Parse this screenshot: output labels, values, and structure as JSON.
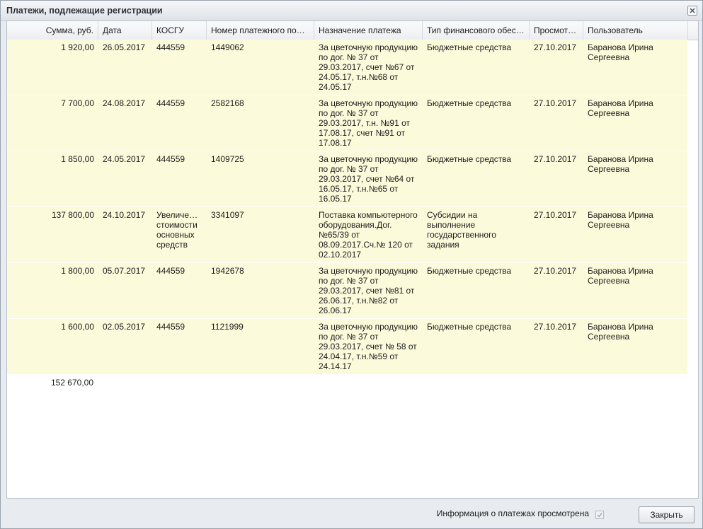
{
  "dialog": {
    "title": "Платежи, подлежащие регистрации"
  },
  "table": {
    "columns": [
      "Сумма, руб.",
      "Дата",
      "КОСГУ",
      "Номер платежного пор…",
      "Назначение платежа",
      "Тип финансового обес…",
      "Просмот…",
      "Пользователь"
    ],
    "rows": [
      [
        "1 920,00",
        "26.05.2017",
        "444559",
        "1449062",
        "За цветочную продукцию по дог. № 37 от 29.03.2017, счет №67 от 24.05.17, т.н.№68 от 24.05.17",
        "Бюджетные средства",
        "27.10.2017",
        "Баранова Ирина Сергеевна"
      ],
      [
        "7 700,00",
        "24.08.2017",
        "444559",
        "2582168",
        "За цветочную продукцию по дог. № 37 от 29.03.2017, т.н. №91 от 17.08.17, счет №91 от 17.08.17",
        "Бюджетные средства",
        "27.10.2017",
        "Баранова Ирина Сергеевна"
      ],
      [
        "1 850,00",
        "24.05.2017",
        "444559",
        "1409725",
        "За цветочную продукцию по дог. № 37 от 29.03.2017, счет №64 от 16.05.17, т.н.№65 от 16.05.17",
        "Бюджетные средства",
        "27.10.2017",
        "Баранова Ирина Сергеевна"
      ],
      [
        "137 800,00",
        "24.10.2017",
        "Увеличе… стоимости основных средств",
        "3341097",
        "Поставка компьютерного оборудования.Дог. №65/39 от 08.09.2017.Сч.№ 120 от 02.10.2017",
        "Субсидии на выполнение государственного задания",
        "27.10.2017",
        "Баранова Ирина Сергеевна"
      ],
      [
        "1 800,00",
        "05.07.2017",
        "444559",
        "1942678",
        "За цветочную продукцию по дог. № 37 от 29.03.2017, счет №81 от 26.06.17, т.н.№82 от 26.06.17",
        "Бюджетные средства",
        "27.10.2017",
        "Баранова Ирина Сергеевна"
      ],
      [
        "1 600,00",
        "02.05.2017",
        "444559",
        "1121999",
        "За цветочную продукцию по дог. № 37 от 29.03.2017, счет № 58 от 24.04.17, т.н.№59 от 24.14.17",
        "Бюджетные средства",
        "27.10.2017",
        "Баранова Ирина Сергеевна"
      ]
    ],
    "total": "152 670,00"
  },
  "footer": {
    "info_label": "Информация о платежах просмотрена",
    "info_checked": true,
    "close_label": "Закрыть"
  },
  "icons": {
    "close": "close-icon",
    "check": "check-icon"
  },
  "colors": {
    "row_background": "#fbfadb",
    "dialog_background": "#e8ebef"
  }
}
